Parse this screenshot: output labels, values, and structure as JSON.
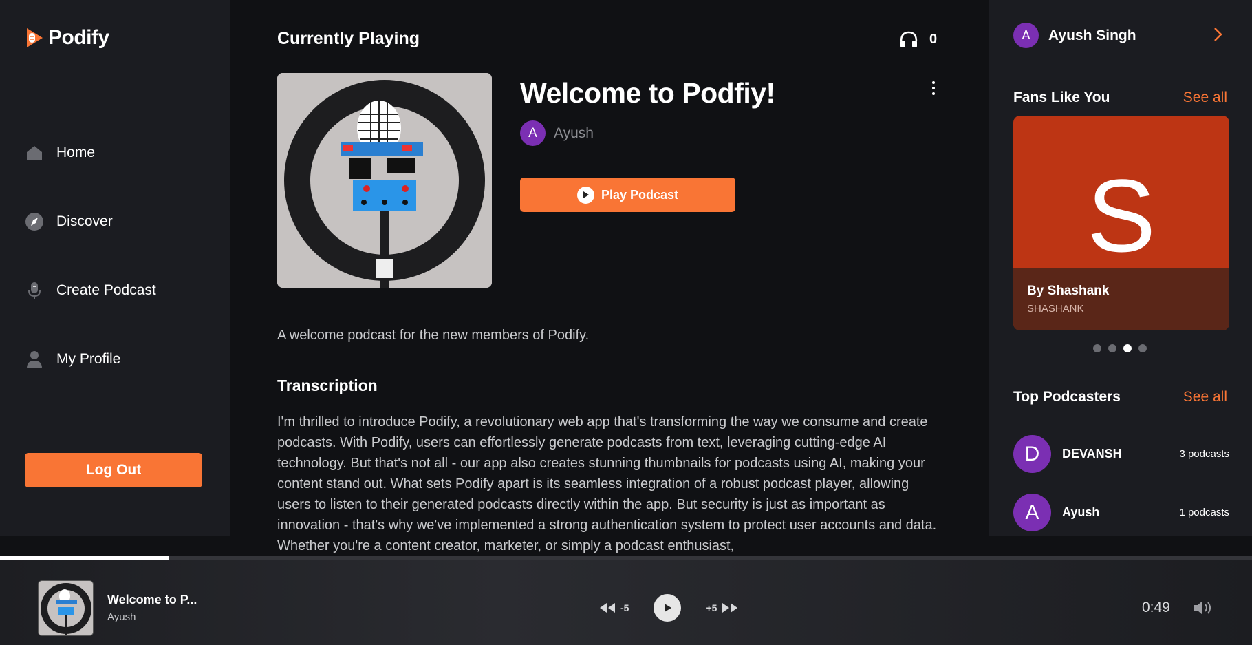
{
  "brand": {
    "name": "Podify"
  },
  "sidebar": {
    "items": [
      {
        "label": "Home",
        "icon": "home-icon"
      },
      {
        "label": "Discover",
        "icon": "compass-icon"
      },
      {
        "label": "Create Podcast",
        "icon": "microphone-icon"
      },
      {
        "label": "My Profile",
        "icon": "user-icon"
      }
    ],
    "logout_label": "Log Out"
  },
  "main": {
    "heading": "Currently Playing",
    "listeners": "0",
    "podcast_title": "Welcome to Podfiy!",
    "author_initial": "A",
    "author_name": "Ayush",
    "play_label": "Play Podcast",
    "description": "A welcome podcast for the new members of Podify.",
    "transcription_heading": "Transcription",
    "transcription": "I'm thrilled to introduce Podify, a revolutionary web app that's transforming the way we consume and create podcasts. With Podify, users can effortlessly generate podcasts from text, leveraging cutting-edge AI technology. But that's not all - our app also creates stunning thumbnails for podcasts using AI, making your content stand out. What sets Podify apart is its seamless integration of a robust podcast player, allowing users to listen to their generated podcasts directly within the app. But security is just as important as innovation - that's why we've implemented a strong authentication system to protect user accounts and data. Whether you're a content creator, marketer, or simply a podcast enthusiast,"
  },
  "right": {
    "user_initial": "A",
    "user_name": "Ayush Singh",
    "fans_title": "Fans Like You",
    "see_all": "See all",
    "fan_card": {
      "letter": "S",
      "title": "By Shashank",
      "subtitle": "SHASHANK"
    },
    "carousel_active": 2,
    "top_title": "Top Podcasters",
    "podcasters": [
      {
        "initial": "D",
        "name": "DEVANSH",
        "count": "3 podcasts"
      },
      {
        "initial": "A",
        "name": "Ayush",
        "count": "1 podcasts"
      }
    ]
  },
  "player": {
    "title": "Welcome to P...",
    "author": "Ayush",
    "rewind_label": "-5",
    "forward_label": "+5",
    "time": "0:49",
    "progress": 0.135
  },
  "colors": {
    "accent": "#f97535",
    "avatar": "#7b2fb3",
    "fan_card": "#bd3514"
  }
}
